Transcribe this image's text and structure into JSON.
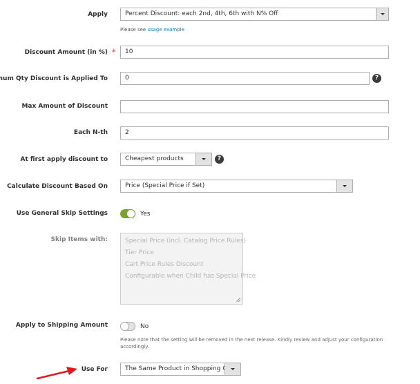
{
  "fields": {
    "apply": {
      "label": "Apply",
      "value": "Percent Discount: each 2nd, 4th, 6th with N% Off",
      "note_prefix": "Please see ",
      "note_link": "usage example"
    },
    "discount_amount": {
      "label": "Discount Amount (in %)",
      "required_mark": "*",
      "value": "10"
    },
    "max_qty": {
      "label": "Maximum Qty Discount is Applied To",
      "value": "0",
      "help_icon": "?"
    },
    "max_amount": {
      "label": "Max Amount of Discount",
      "value": ""
    },
    "each_nth": {
      "label": "Each N-th",
      "value": "2"
    },
    "first_apply": {
      "label": "At first apply discount to",
      "value": "Cheapest products",
      "help_icon": "?"
    },
    "calculate": {
      "label": "Calculate Discount Based On",
      "value": "Price (Special Price if Set)"
    },
    "general_skip": {
      "label": "Use General Skip Settings",
      "state": "Yes",
      "on": true
    },
    "skip_items": {
      "label": "Skip Items with:",
      "options": [
        "Special Price (incl. Catalog Price Rules)",
        "Tier Price",
        "Cart Price Rules Discount",
        "Configurable when Child has Special Price"
      ]
    },
    "shipping": {
      "label": "Apply to Shipping Amount",
      "state": "No",
      "on": false,
      "note": "Please note that the setting will be removed in the next release. Kindly review and adjust your configuration accordingly."
    },
    "use_for": {
      "label": "Use For",
      "value": "The Same Product in Shopping Cart"
    }
  },
  "colors": {
    "toggle_on": "#79a22e",
    "required": "#e22626",
    "link": "#1979c3",
    "annotation_arrow": "#e0191b"
  }
}
